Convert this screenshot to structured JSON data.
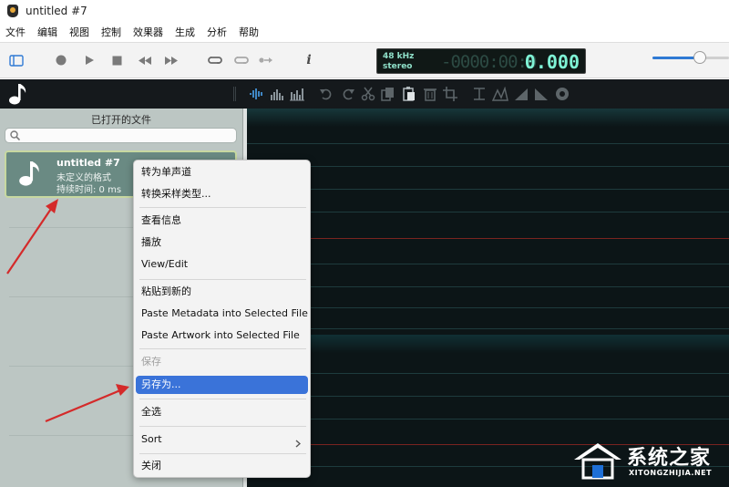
{
  "window": {
    "title": "untitled #7"
  },
  "menubar": {
    "items": [
      "文件",
      "编辑",
      "视图",
      "控制",
      "效果器",
      "生成",
      "分析",
      "帮助"
    ]
  },
  "transport": {
    "icons": [
      "sidebar-toggle-icon",
      "record-icon",
      "play-icon",
      "stop-icon",
      "rewind-icon",
      "fast-forward-icon",
      "loop-icon",
      "repeat-icon",
      "skip-icon",
      "info-icon"
    ],
    "info_label": "i",
    "sample_rate": "48 kHz",
    "channels": "stereo",
    "time_ghost": "-0000:00:0",
    "time_value": "0.000",
    "volume": 0.62
  },
  "edit_toolbar": {
    "icons": [
      "waveform-icon",
      "spectrum-icon",
      "spectrogram-icon",
      "undo-icon",
      "redo-icon",
      "cut-icon",
      "copy-icon",
      "paste-icon",
      "delete-icon",
      "crop-icon",
      "trim-icon",
      "normalize-icon",
      "fade-in-icon",
      "fade-out-icon",
      "record-small-icon"
    ]
  },
  "sidebar": {
    "title": "已打开的文件",
    "search": {
      "placeholder": "",
      "value": ""
    },
    "files": [
      {
        "name": "untitled #7",
        "format": "未定义的格式",
        "duration": "持续时间: 0 ms"
      }
    ]
  },
  "context_menu": {
    "items": [
      {
        "label": "转为单声道",
        "disabled": false
      },
      {
        "label": "转换采样类型...",
        "disabled": false
      },
      {
        "label": "查看信息",
        "disabled": false
      },
      {
        "label": "播放",
        "disabled": false
      },
      {
        "label": "View/Edit",
        "disabled": false
      },
      {
        "label": "粘贴到新的",
        "disabled": false
      },
      {
        "label": "Paste Metadata into Selected File",
        "disabled": false
      },
      {
        "label": "Paste Artwork into Selected File",
        "disabled": false
      },
      {
        "label": "保存",
        "disabled": true
      },
      {
        "label": "另存为...",
        "disabled": false,
        "selected": true
      },
      {
        "label": "全选",
        "disabled": false
      },
      {
        "label": "Sort",
        "disabled": false,
        "submenu": true
      },
      {
        "label": "关闭",
        "disabled": false
      }
    ]
  },
  "colors": {
    "accent": "#3a73d9",
    "sidebar_bg": "#bcc6c3",
    "file_card_bg": "#6a8a83",
    "waveform_bg": "#0c1517",
    "lcd_text": "#7ff3d5",
    "annotation_arrow": "#d42a2a"
  },
  "watermark": {
    "brand": "系统之家",
    "url": "XITONGZHIJIA.NET"
  }
}
